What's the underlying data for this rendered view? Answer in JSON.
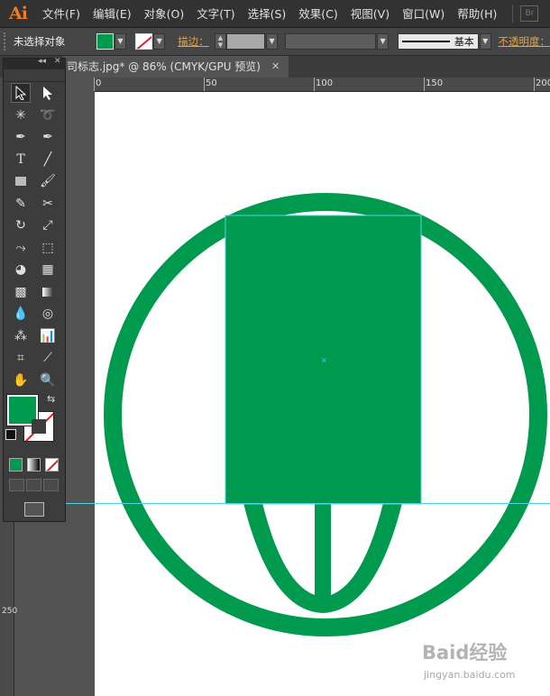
{
  "app": {
    "logo_text": "Ai",
    "br_badge": "Br"
  },
  "menu": [
    {
      "label": "文件(F)"
    },
    {
      "label": "编辑(E)"
    },
    {
      "label": "对象(O)"
    },
    {
      "label": "文字(T)"
    },
    {
      "label": "选择(S)"
    },
    {
      "label": "效果(C)"
    },
    {
      "label": "视图(V)"
    },
    {
      "label": "窗口(W)"
    },
    {
      "label": "帮助(H)"
    }
  ],
  "control_bar": {
    "selection_status": "未选择对象",
    "stroke_label": "描边：",
    "brush_label": "基本",
    "opacity_label": "不透明度："
  },
  "document_tab": {
    "title": "司标志.jpg* @ 86% (CMYK/GPU 预览)",
    "close": "✕"
  },
  "ruler": {
    "h_labels": [
      "0",
      "50",
      "100",
      "150",
      "200"
    ],
    "v_label": "250"
  },
  "colors": {
    "accent_green": "#009a4e",
    "guide_cyan": "#4fd4e6",
    "stroke_red": "#e02020",
    "label_orange": "#e8a43c"
  },
  "tools_panel": {
    "collapse_glyph": "◂◂",
    "close_glyph": "✕"
  },
  "watermark": {
    "text": "Baid经验",
    "sub": "jingyan.baidu.com"
  }
}
